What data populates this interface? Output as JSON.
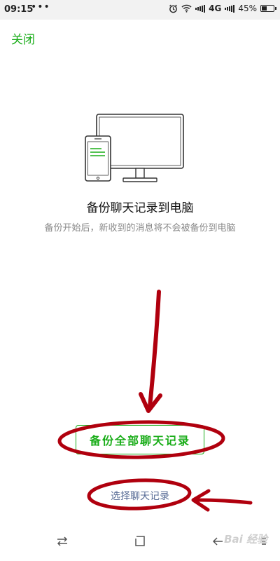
{
  "status_bar": {
    "time": "09:15",
    "dots": "•••",
    "network": "4G",
    "battery": "45%",
    "battery_level": 0.45
  },
  "header": {
    "close_label": "关闭"
  },
  "main": {
    "title": "备份聊天记录到电脑",
    "subtitle": "备份开始后，新收到的消息将不会被备份到电脑",
    "backup_all_label": "备份全部聊天记录",
    "select_chats_label": "选择聊天记录"
  },
  "watermark": {
    "text": "Bai 经验"
  },
  "colors": {
    "accent": "#1aad19",
    "link": "#576b95",
    "annotation": "#b0000e"
  }
}
